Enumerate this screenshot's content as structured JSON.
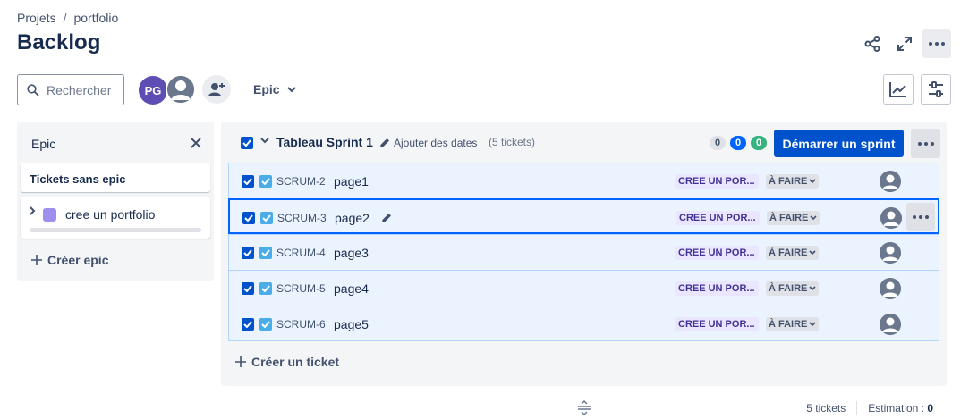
{
  "breadcrumb": {
    "project_root": "Projets",
    "separator": "/",
    "project": "portfolio"
  },
  "page": {
    "title": "Backlog"
  },
  "toolbar": {
    "search_placeholder": "Rechercher",
    "avatar_initials": "PG",
    "epic_filter_label": "Epic"
  },
  "epic_panel": {
    "title": "Epic",
    "no_epic_label": "Tickets sans epic",
    "epics": [
      {
        "name": "cree un portfolio",
        "color": "#9f8fef"
      }
    ],
    "create_label": "Créer epic"
  },
  "sprint": {
    "name": "Tableau Sprint 1",
    "add_dates_label": "Ajouter des dates",
    "ticket_count_label": "(5 tickets)",
    "counts": {
      "todo": "0",
      "in_progress": "0",
      "done": "0"
    },
    "start_button_label": "Démarrer un sprint",
    "issues": [
      {
        "key": "SCRUM-2",
        "summary": "page1",
        "epic": "CREE UN POR...",
        "status": "À FAIRE"
      },
      {
        "key": "SCRUM-3",
        "summary": "page2",
        "epic": "CREE UN POR...",
        "status": "À FAIRE"
      },
      {
        "key": "SCRUM-4",
        "summary": "page3",
        "epic": "CREE UN POR...",
        "status": "À FAIRE"
      },
      {
        "key": "SCRUM-5",
        "summary": "page4",
        "epic": "CREE UN POR...",
        "status": "À FAIRE"
      },
      {
        "key": "SCRUM-6",
        "summary": "page5",
        "epic": "CREE UN POR...",
        "status": "À FAIRE"
      }
    ],
    "create_ticket_label": "Créer un ticket"
  },
  "footer": {
    "tickets_label": "5 tickets",
    "estimation_label": "Estimation :",
    "estimation_value": "0"
  },
  "colors": {
    "primary": "#0052cc",
    "epic_purple": "#9f8fef",
    "done_green": "#36b37e",
    "in_progress_blue": "#0065ff"
  }
}
